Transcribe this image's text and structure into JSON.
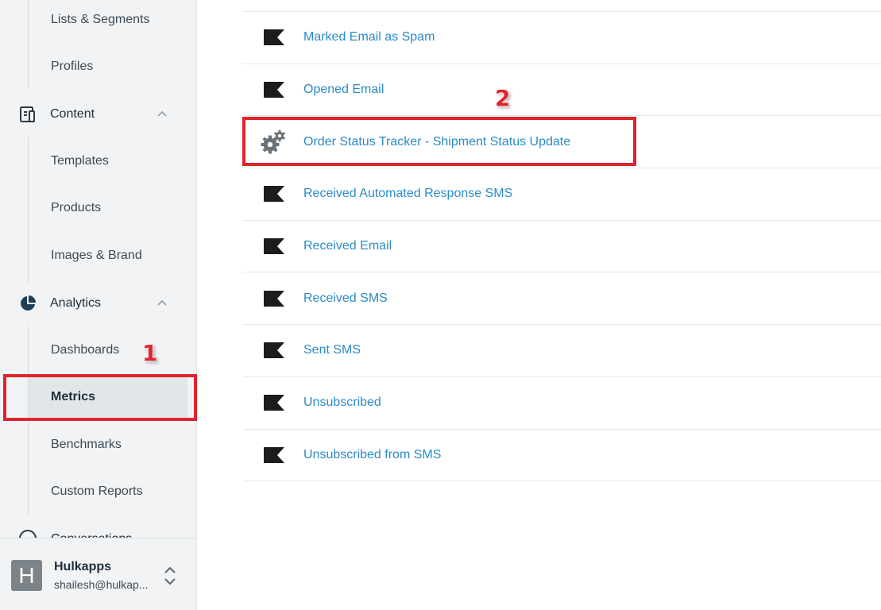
{
  "sidebar": {
    "items": [
      {
        "label": "Lists & Segments",
        "type": "sub"
      },
      {
        "label": "Profiles",
        "type": "sub"
      },
      {
        "label": "Content",
        "type": "section",
        "icon": "document-icon"
      },
      {
        "label": "Templates",
        "type": "sub"
      },
      {
        "label": "Products",
        "type": "sub"
      },
      {
        "label": "Images & Brand",
        "type": "sub"
      },
      {
        "label": "Analytics",
        "type": "section",
        "icon": "pie-chart-icon"
      },
      {
        "label": "Dashboards",
        "type": "sub"
      },
      {
        "label": "Metrics",
        "type": "sub",
        "active": true
      },
      {
        "label": "Benchmarks",
        "type": "sub"
      },
      {
        "label": "Custom Reports",
        "type": "sub"
      },
      {
        "label": "Conversations",
        "type": "section",
        "icon": "chat-icon"
      }
    ]
  },
  "account": {
    "avatar_initial": "H",
    "name": "Hulkapps",
    "email": "shailesh@hulkap..."
  },
  "metrics": [
    {
      "label": "Marked Email as Spam",
      "icon": "flag-icon"
    },
    {
      "label": "Opened Email",
      "icon": "flag-icon"
    },
    {
      "label": "Order Status Tracker - Shipment Status Update",
      "icon": "gears-icon"
    },
    {
      "label": "Received Automated Response SMS",
      "icon": "flag-icon"
    },
    {
      "label": "Received Email",
      "icon": "flag-icon"
    },
    {
      "label": "Received SMS",
      "icon": "flag-icon"
    },
    {
      "label": "Sent SMS",
      "icon": "flag-icon"
    },
    {
      "label": "Unsubscribed",
      "icon": "flag-icon"
    },
    {
      "label": "Unsubscribed from SMS",
      "icon": "flag-icon"
    }
  ],
  "annotations": {
    "step1": "1",
    "step2": "2",
    "color": "#e0242e"
  },
  "colors": {
    "link": "#2a8bc7",
    "sidebar_bg": "#f1f3f4",
    "active_bg": "#e3e6e9",
    "text_dark": "#1f2d3a"
  }
}
